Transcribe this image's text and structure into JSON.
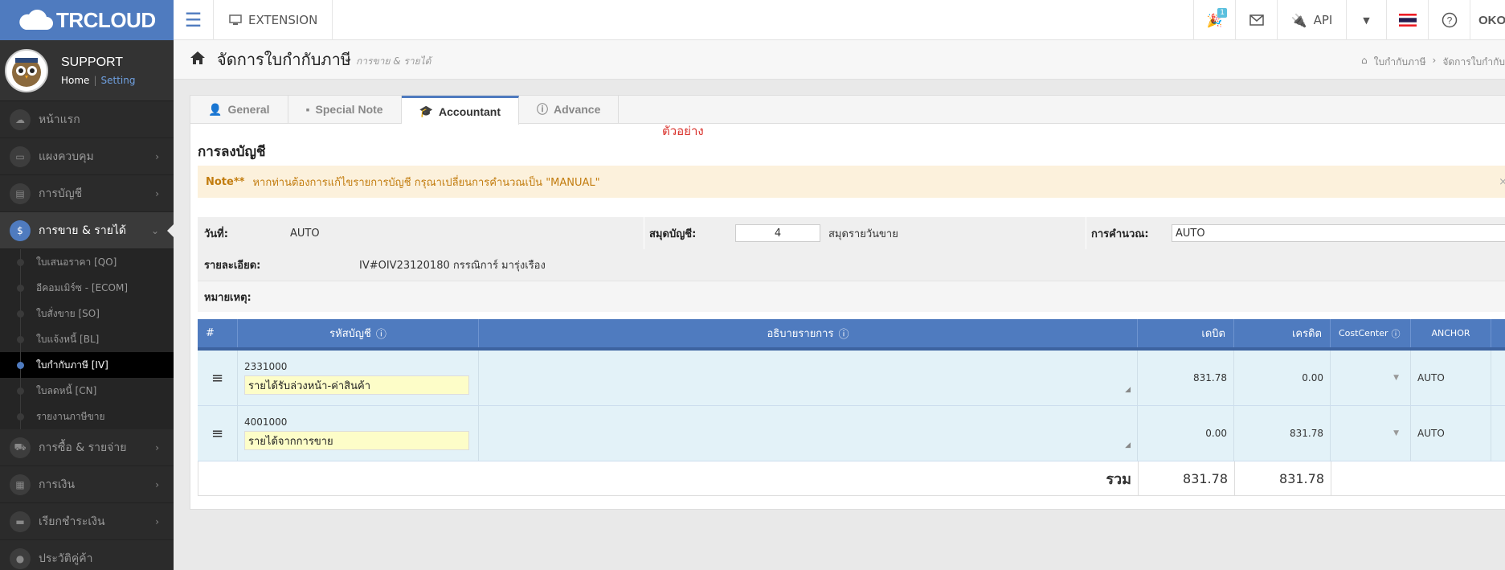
{
  "topbar": {
    "logo_text": "TRCLOUD",
    "extension_label": "EXTENSION",
    "notification_count": "1",
    "api_label": "API",
    "user_label": "OKOL"
  },
  "sidebar": {
    "profile_name": "SUPPORT",
    "home_link": "Home",
    "setting_link": "Setting",
    "items": [
      {
        "label": "หน้าแรก",
        "icon": "cloud-icon"
      },
      {
        "label": "แผงควบคุม",
        "icon": "monitor-icon"
      },
      {
        "label": "การบัญชี",
        "icon": "book-icon"
      },
      {
        "label": "การขาย & รายได้",
        "icon": "dollar-icon"
      }
    ],
    "sub_items": [
      "ใบเสนอราคา [QO]",
      "อีคอมเมิร์ซ - [ECOM]",
      "ใบสั่งขาย [SO]",
      "ใบแจ้งหนี้ [BL]",
      "ใบกำกับภาษี [IV]",
      "ใบลดหนี้ [CN]",
      "รายงานภาษีขาย"
    ],
    "items2": [
      {
        "label": "การซื้อ & รายจ่าย",
        "icon": "cart-icon"
      },
      {
        "label": "การเงิน",
        "icon": "calendar-icon"
      },
      {
        "label": "เรียกชำระเงิน",
        "icon": "card-icon"
      },
      {
        "label": "ประวัติคู่ค้า",
        "icon": "user-icon"
      }
    ]
  },
  "header": {
    "title": "จัดการใบกำกับภาษี",
    "subtitle": "การขาย & รายได้",
    "breadcrumb_1": "ใบกำกับภาษี",
    "breadcrumb_2": "จัดการใบกำกับ"
  },
  "tabs": [
    "General",
    "Special Note",
    "Accountant",
    "Advance"
  ],
  "sample_label": "ตัวอย่าง",
  "section_title": "การลงบัญชี",
  "note": {
    "prefix": "Note**",
    "text": "หากท่านต้องการแก้ไขรายการบัญชี กรุณาเปลี่ยนการคำนวณเป็น \"MANUAL\""
  },
  "form": {
    "date_label": "วันที่:",
    "date_value": "AUTO",
    "journal_label": "สมุดบัญชี:",
    "journal_value": "4",
    "journal_name": "สมุดรายวันขาย",
    "calc_label": "การคำนวณ:",
    "calc_value": "AUTO",
    "detail_label": "รายละเอียด:",
    "detail_value": "IV#OIV23120180 กรรณิการ์ มารุ่งเรือง",
    "remark_label": "หมายเหตุ:"
  },
  "table": {
    "headers": {
      "num": "#",
      "account": "รหัสบัญชี",
      "description": "อธิบายรายการ",
      "debit": "เดบิต",
      "credit": "เครดิต",
      "cost_center": "CostCenter",
      "anchor": "ANCHOR"
    },
    "rows": [
      {
        "code": "2331000",
        "name": "รายได้รับล่วงหน้า-ค่าสินค้า",
        "debit": "831.78",
        "credit": "0.00",
        "anchor": "AUTO"
      },
      {
        "code": "4001000",
        "name": "รายได้จากการขาย",
        "debit": "0.00",
        "credit": "831.78",
        "anchor": "AUTO"
      }
    ],
    "total_label": "รวม",
    "total_debit": "831.78",
    "total_credit": "831.78"
  }
}
